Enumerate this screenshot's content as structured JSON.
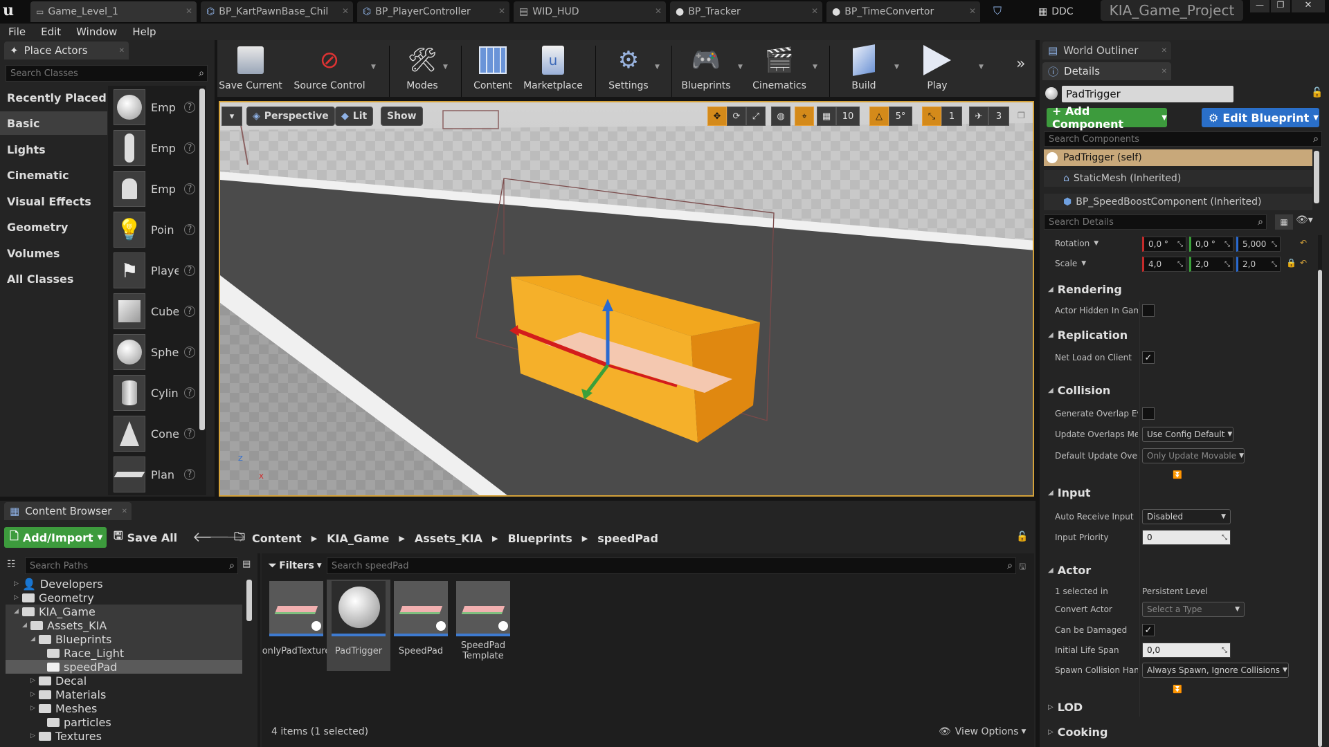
{
  "tabs": [
    {
      "label": "Game_Level_1"
    },
    {
      "label": "BP_KartPawnBase_Chil"
    },
    {
      "label": "BP_PlayerController"
    },
    {
      "label": "WID_HUD"
    },
    {
      "label": "BP_Tracker"
    },
    {
      "label": "BP_TimeConvertor"
    }
  ],
  "titlebar": {
    "ddc": "DDC",
    "project": "KIA_Game_Project"
  },
  "menu": [
    "File",
    "Edit",
    "Window",
    "Help"
  ],
  "place_actors": {
    "title": "Place Actors",
    "search_placeholder": "Search Classes",
    "categories": [
      "Recently Placed",
      "Basic",
      "Lights",
      "Cinematic",
      "Visual Effects",
      "Geometry",
      "Volumes",
      "All Classes"
    ],
    "selected_category": "Basic",
    "actors": [
      "Emp",
      "Emp",
      "Emp",
      "Poin",
      "Playe",
      "Cube",
      "Sphe",
      "Cylin",
      "Cone",
      "Plan"
    ]
  },
  "toolbar": {
    "save_current": "Save Current",
    "source_control": "Source Control",
    "modes": "Modes",
    "content": "Content",
    "marketplace": "Marketplace",
    "settings": "Settings",
    "blueprints": "Blueprints",
    "cinematics": "Cinematics",
    "build": "Build",
    "play": "Play"
  },
  "viewport": {
    "perspective": "Perspective",
    "lit": "Lit",
    "show": "Show",
    "grid_snap": "10",
    "rot_snap": "5°",
    "scale_snap": "1",
    "cam_speed": "3"
  },
  "content_browser": {
    "title": "Content Browser",
    "add_import": "Add/Import",
    "save_all": "Save All",
    "breadcrumb": [
      "Content",
      "KIA_Game",
      "Assets_KIA",
      "Blueprints",
      "speedPad"
    ],
    "search_paths_placeholder": "Search Paths",
    "filters": "Filters",
    "search_placeholder": "Search speedPad",
    "tree": [
      {
        "label": "Developers",
        "depth": 0
      },
      {
        "label": "Geometry",
        "depth": 0
      },
      {
        "label": "KIA_Game",
        "depth": 0
      },
      {
        "label": "Assets_KIA",
        "depth": 1
      },
      {
        "label": "Blueprints",
        "depth": 2
      },
      {
        "label": "Race_Light",
        "depth": 3
      },
      {
        "label": "speedPad",
        "depth": 3
      },
      {
        "label": "Decal",
        "depth": 2
      },
      {
        "label": "Materials",
        "depth": 2
      },
      {
        "label": "Meshes",
        "depth": 2
      },
      {
        "label": "particles",
        "depth": 2
      },
      {
        "label": "Textures",
        "depth": 2
      }
    ],
    "assets": [
      "onlyPadTexture",
      "PadTrigger",
      "SpeedPad",
      "SpeedPad Template"
    ],
    "status": "4 items (1 selected)",
    "view_options": "View Options"
  },
  "world_outliner": {
    "title": "World Outliner"
  },
  "details": {
    "title": "Details",
    "object_name": "PadTrigger",
    "add_component": "+ Add Component",
    "edit_blueprint": "Edit Blueprint",
    "search_components_placeholder": "Search Components",
    "components": [
      "PadTrigger (self)",
      "StaticMesh (Inherited)",
      "BP_SpeedBoostComponent (Inherited)"
    ],
    "search_details_placeholder": "Search Details",
    "rotation_label": "Rotation",
    "rotation": [
      "0,0 °",
      "0,0 °",
      "5,000"
    ],
    "scale_label": "Scale",
    "scale": [
      "4,0",
      "2,0",
      "2,0"
    ],
    "sections": {
      "rendering": "Rendering",
      "replication": "Replication",
      "collision": "Collision",
      "input": "Input",
      "actor": "Actor",
      "lod": "LOD",
      "cooking": "Cooking"
    },
    "props": {
      "actor_hidden": "Actor Hidden In Gam",
      "net_load": "Net Load on Client",
      "gen_overlap": "Generate Overlap Ev",
      "update_overlaps": "Update Overlaps Me",
      "update_overlaps_val": "Use Config Default",
      "default_update": "Default Update Over",
      "default_update_val": "Only Update Movable",
      "auto_receive": "Auto Receive Input",
      "auto_receive_val": "Disabled",
      "input_priority": "Input Priority",
      "input_priority_val": "0",
      "selected_in": "1 selected in",
      "selected_in_val": "Persistent Level",
      "convert_actor": "Convert Actor",
      "convert_actor_val": "Select a Type",
      "can_be_damaged": "Can be Damaged",
      "initial_life": "Initial Life Span",
      "initial_life_val": "0,0",
      "spawn_collision": "Spawn Collision Han",
      "spawn_collision_val": "Always Spawn, Ignore Collisions"
    },
    "checks": {
      "actor_hidden": false,
      "net_load": true,
      "gen_overlap": false,
      "can_be_damaged": true
    }
  },
  "colors": {
    "accent_orange": "#d48a1a",
    "add_green": "#3d9b3d",
    "edit_blue": "#2a6fc9",
    "selected_row": "#c8a87a"
  }
}
